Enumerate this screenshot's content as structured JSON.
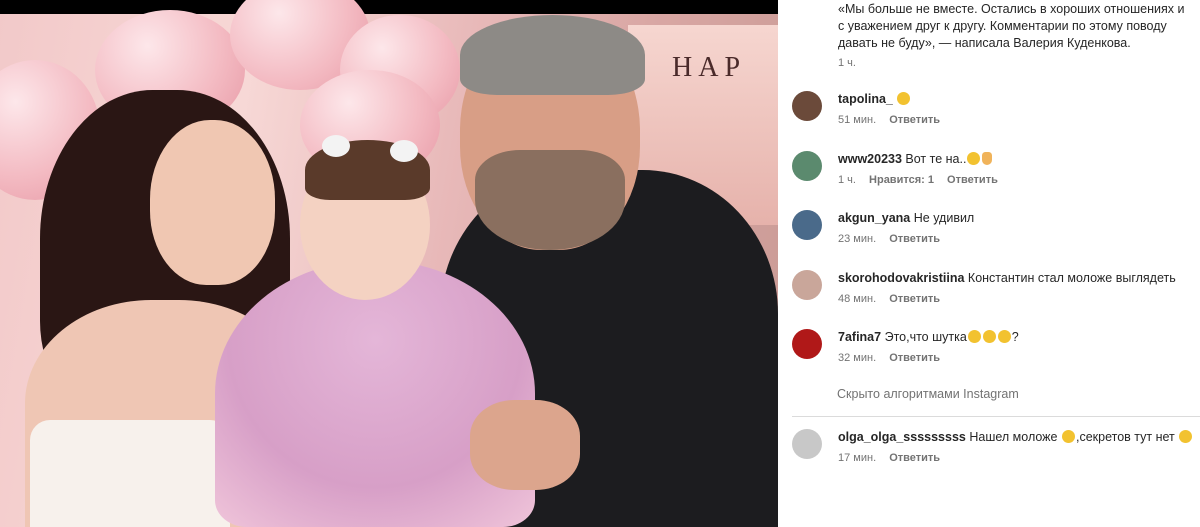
{
  "post": {
    "caption": "«Мы больше не вместе. Остались в хороших отношениях и с уважением друг к другу. Комментарии по этому поводу давать не буду», — написала Валерия Куденкова.",
    "time": "1 ч."
  },
  "photo_sign_text": "HAP",
  "comments": [
    {
      "username": "tapolina_",
      "text": "",
      "emojis": [
        "pensive-face"
      ],
      "time": "51 мин.",
      "likes": "",
      "reply": "Ответить",
      "avatar_color": "#6b4a3a"
    },
    {
      "username": "www20233",
      "text": "Вот те на..",
      "emojis": [
        "surprised-face",
        "ok-hand"
      ],
      "time": "1 ч.",
      "likes": "Нравится: 1",
      "reply": "Ответить",
      "avatar_color": "#5b8a6e"
    },
    {
      "username": "akgun_yana",
      "text": "Не удивил",
      "emojis": [],
      "time": "23 мин.",
      "likes": "",
      "reply": "Ответить",
      "avatar_color": "#4a6a8a"
    },
    {
      "username": "skorohodovakristiina",
      "text": "Константин стал моложе выглядеть",
      "emojis": [],
      "time": "48 мин.",
      "likes": "",
      "reply": "Ответить",
      "avatar_color": "#c9a69a"
    },
    {
      "username": "7afina7",
      "text": "Это,что шутка",
      "text_suffix": "?",
      "emojis": [
        "surprised-face",
        "surprised-face",
        "surprised-face"
      ],
      "time": "32 мин.",
      "likes": "",
      "reply": "Ответить",
      "avatar_color": "#b01818"
    }
  ],
  "hidden_label": "Скрыто алгоритмами Instagram",
  "hidden_comment": {
    "username": "olga_olga_sssssssss",
    "text_before": "Нашел моложе",
    "text_middle": ",секретов тут нет",
    "time": "17 мин.",
    "reply": "Ответить",
    "avatar_color": "#c8c8c8"
  }
}
